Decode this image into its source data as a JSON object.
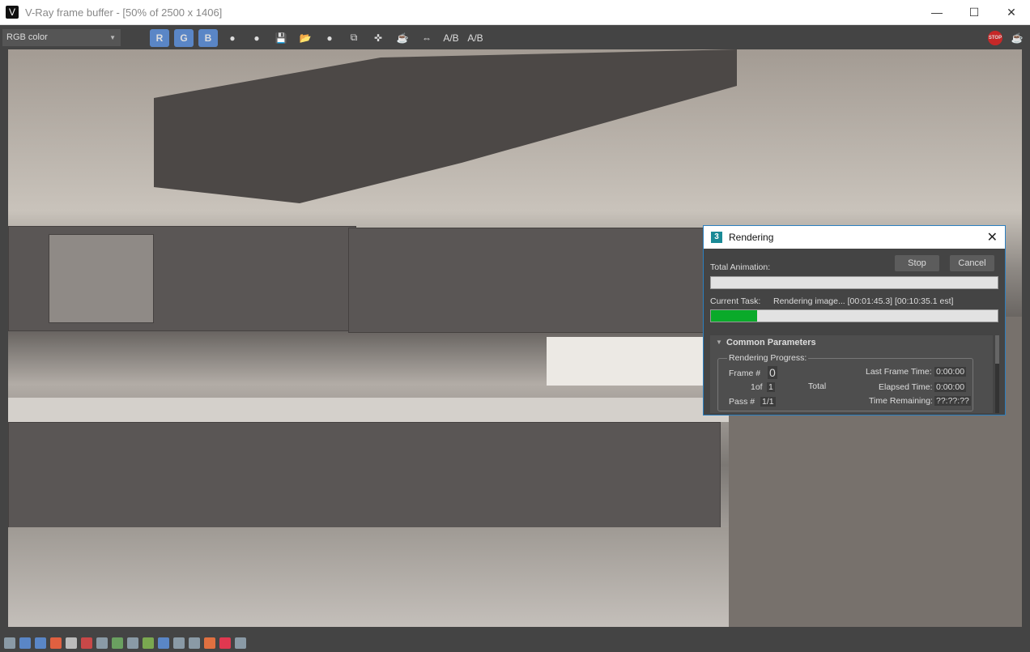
{
  "window": {
    "title": "V-Ray frame buffer - [50% of 2500 x 1406]",
    "minimize": "—",
    "maximize": "☐",
    "close": "✕"
  },
  "toolbar": {
    "channel_select": "RGB color",
    "buttons": [
      {
        "name": "color-corrections-icon",
        "label": ""
      },
      {
        "name": "red-channel-button",
        "label": "R"
      },
      {
        "name": "green-channel-button",
        "label": "G"
      },
      {
        "name": "blue-channel-button",
        "label": "B"
      },
      {
        "name": "view-alpha-icon",
        "label": "●"
      },
      {
        "name": "monochrome-icon",
        "label": "●"
      },
      {
        "name": "save-icon",
        "label": "💾"
      },
      {
        "name": "open-icon",
        "label": "📂"
      },
      {
        "name": "clear-icon",
        "label": "●"
      },
      {
        "name": "duplicate-to-max-fb-icon",
        "label": "⧉"
      },
      {
        "name": "track-mouse-icon",
        "label": "✜"
      },
      {
        "name": "render-region-teapot-icon",
        "label": "☕"
      },
      {
        "name": "compare-ab-icon",
        "label": "⇔"
      },
      {
        "name": "ab-horizontal-icon",
        "label": "A/B"
      },
      {
        "name": "ab-vertical-icon",
        "label": "A/B"
      }
    ],
    "stop_icon": "STOP",
    "render_icon": "☕"
  },
  "dialog": {
    "title": "Rendering",
    "app_icon": "3",
    "close": "✕",
    "stop_label": "Stop",
    "cancel_label": "Cancel",
    "total_animation_label": "Total Animation:",
    "total_animation_progress": 0,
    "current_task_label": "Current Task:",
    "current_task_value": "Rendering image... [00:01:45.3] [00:10:35.1 est]",
    "current_task_progress": 16,
    "rollout_title": "Common Parameters",
    "group_title": "Rendering Progress:",
    "frame_label": "Frame #",
    "frame_value": "0",
    "of_value": "1of",
    "of_total": "1",
    "total_label": "Total",
    "pass_label": "Pass #",
    "pass_value": "1/1",
    "last_frame_time_label": "Last Frame Time:",
    "last_frame_time": "0:00:00",
    "elapsed_time_label": "Elapsed Time:",
    "elapsed_time": "0:00:00",
    "time_remaining_label": "Time Remaining:",
    "time_remaining": "??:??:??"
  },
  "bottombar": {
    "icons": [
      "window-icon",
      "layers-icon",
      "info-icon",
      "gradient-icon",
      "hsl-icon",
      "color-balance-icon",
      "histogram-icon",
      "curves-icon",
      "exposure-icon",
      "background-image-icon",
      "lens-effects-icon",
      "lut-icon",
      "history-icon",
      "stereo-icon",
      "ocio-icon",
      "denoise-icon"
    ],
    "colors": [
      "#8a9aa6",
      "#5a86c6",
      "#5a86c6",
      "#e06040",
      "#bbbbbb",
      "#c84848",
      "#8a9aa6",
      "#6aa060",
      "#8a9aa6",
      "#7aa850",
      "#5a86c6",
      "#8a9aa6",
      "#8a9aa6",
      "#e07040",
      "#e03850",
      "#8a9aa6"
    ]
  }
}
